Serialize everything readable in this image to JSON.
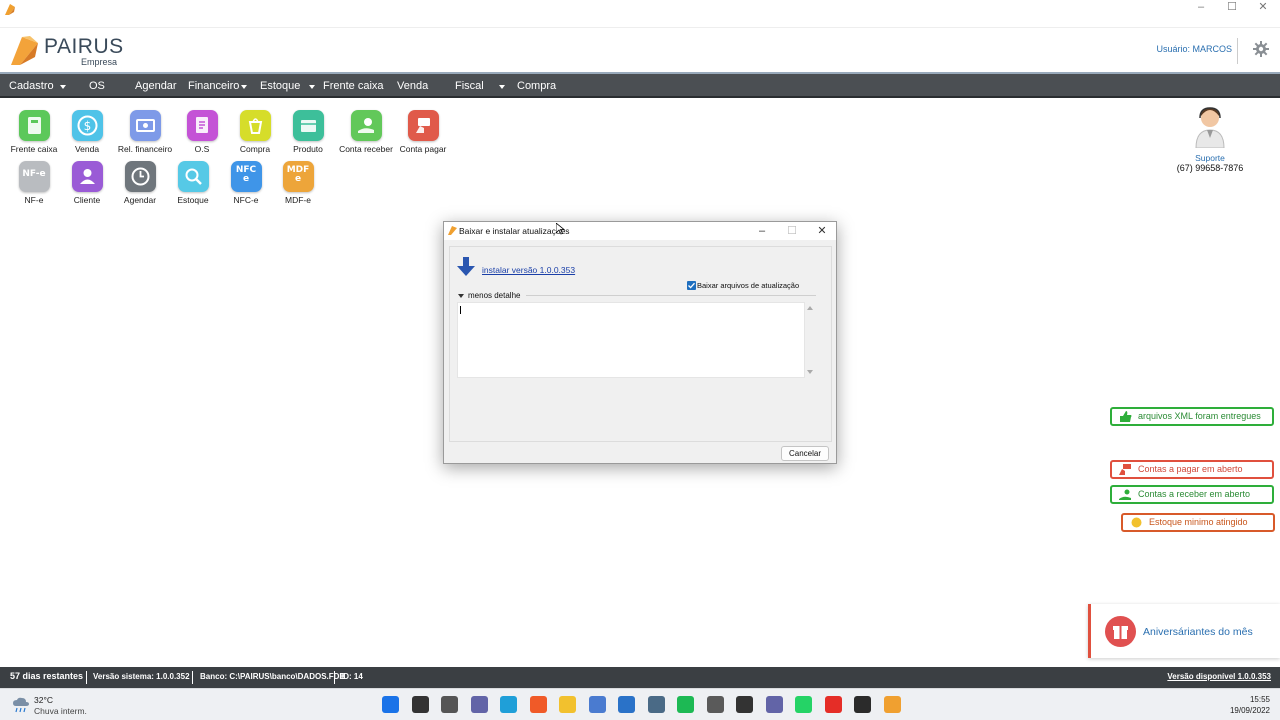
{
  "window": {
    "controls": [
      "–",
      "☐",
      "✕"
    ]
  },
  "brand": {
    "name": "PAIRUS",
    "subtitle": "Empresa"
  },
  "header": {
    "user_label": "Usuário: MARCOS",
    "settings_icon": "gear-icon"
  },
  "menu": {
    "items": [
      {
        "label": "Cadastro",
        "dropdown": true
      },
      {
        "label": "OS",
        "dropdown": false
      },
      {
        "label": "Agendar",
        "dropdown": false
      },
      {
        "label": "Financeiro",
        "dropdown": true
      },
      {
        "label": "Estoque",
        "dropdown": true
      },
      {
        "label": "Frente caixa",
        "dropdown": false
      },
      {
        "label": "Venda",
        "dropdown": false
      },
      {
        "label": "Fiscal",
        "dropdown": true
      },
      {
        "label": "Compra",
        "dropdown": false
      }
    ]
  },
  "shortcuts": {
    "row1": [
      {
        "label": "Frente caixa",
        "color": "#5cc85a",
        "icon": "cash-register-icon"
      },
      {
        "label": "Venda",
        "color": "#4fc3e8",
        "icon": "dollar-icon"
      },
      {
        "label": "Rel. financeiro",
        "color": "#7e9ae8",
        "icon": "money-report-icon"
      },
      {
        "label": "O.S",
        "color": "#c453d6",
        "icon": "service-order-icon"
      },
      {
        "label": "Compra",
        "color": "#d6dd2a",
        "icon": "shopping-icon"
      },
      {
        "label": "Produto",
        "color": "#3dbf9a",
        "icon": "product-box-icon"
      },
      {
        "label": "Conta receber",
        "color": "#62c85a",
        "icon": "receive-money-icon"
      },
      {
        "label": "Conta pagar",
        "color": "#e05a4a",
        "icon": "pay-money-icon"
      }
    ],
    "row2": [
      {
        "label": "NF-e",
        "color": "#b9bcc0",
        "icon": "nfe-icon",
        "text": "NF-e"
      },
      {
        "label": "Cliente",
        "color": "#9a5bd6",
        "icon": "client-icon"
      },
      {
        "label": "Agendar",
        "color": "#6f767c",
        "icon": "schedule-24h-icon"
      },
      {
        "label": "Estoque",
        "color": "#56c9e6",
        "icon": "stock-search-icon"
      },
      {
        "label": "NFC-e",
        "color": "#3f95e8",
        "icon": "nfce-icon",
        "text": "NFC\ne"
      },
      {
        "label": "MDF-e",
        "color": "#eda53a",
        "icon": "mdfe-icon",
        "text": "MDF\ne"
      }
    ]
  },
  "support": {
    "label": "Suporte",
    "phone": "(67) 99658-7876"
  },
  "alerts": {
    "xml": "arquivos XML foram entregues",
    "pagar": "Contas a pagar em aberto",
    "receber": "Contas a receber em aberto",
    "estoque": "Estoque minimo atingido"
  },
  "birthday": {
    "label": "Aniversáriantes do mês"
  },
  "statusbar": {
    "days": "57 dias restantes",
    "version": "Versão sistema: 1.0.0.352",
    "db": "Banco: C:\\PAIRUS\\banco\\DADOS.FDB",
    "id": "ID: 14",
    "available": "Versão disponível 1.0.0.353"
  },
  "dialog": {
    "title": "Baixar e instalar atualizações",
    "install_link": "instalar versão 1.0.0.353",
    "checkbox_label": "Baixar arquivos de atualização",
    "checkbox_checked": true,
    "expander_label": "menos detalhe",
    "cancel_label": "Cancelar"
  },
  "taskbar": {
    "weather_temp": "32°C",
    "weather_desc": "Chuva interm.",
    "time": "15:55",
    "date": "19/09/2022",
    "apps": [
      {
        "name": "start-icon",
        "color": "#1a73e8"
      },
      {
        "name": "search-icon",
        "color": "#333333"
      },
      {
        "name": "task-view-icon",
        "color": "#555555"
      },
      {
        "name": "teams-chat-icon",
        "color": "#6264a7"
      },
      {
        "name": "edge-icon",
        "color": "#1f9fd8"
      },
      {
        "name": "brave-icon",
        "color": "#f05a28"
      },
      {
        "name": "explorer-icon",
        "color": "#f2c12e"
      },
      {
        "name": "store-icon",
        "color": "#4a7bd0"
      },
      {
        "name": "mail-icon",
        "color": "#2a72c8"
      },
      {
        "name": "calculator-icon",
        "color": "#4a6a86"
      },
      {
        "name": "spotify-icon",
        "color": "#1db954"
      },
      {
        "name": "browser-icon",
        "color": "#5a5a5a"
      },
      {
        "name": "notes-icon",
        "color": "#333333"
      },
      {
        "name": "teams-icon",
        "color": "#6264a7"
      },
      {
        "name": "whatsapp-icon",
        "color": "#25d366"
      },
      {
        "name": "youtube-icon",
        "color": "#e52d27"
      },
      {
        "name": "app-icon",
        "color": "#2b2b2b"
      },
      {
        "name": "pairus-icon",
        "color": "#f0a030"
      }
    ]
  }
}
